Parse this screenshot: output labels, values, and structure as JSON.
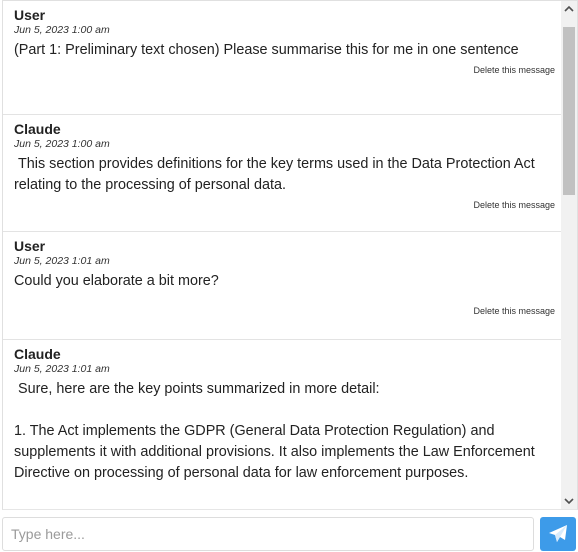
{
  "messages": [
    {
      "author": "User",
      "time": "Jun 5, 2023 1:00 am",
      "text": "(Part 1: Preliminary text chosen) Please summarise this for me in one sentence",
      "delete_label": "Delete this message"
    },
    {
      "author": "Claude",
      "time": "Jun 5, 2023 1:00 am",
      "text": " This section provides definitions for the key terms used in the Data Protection Act relating to the processing of personal data.",
      "delete_label": "Delete this message"
    },
    {
      "author": "User",
      "time": "Jun 5, 2023 1:01 am",
      "text": "Could you elaborate a bit more?",
      "delete_label": "Delete this message"
    },
    {
      "author": "Claude",
      "time": "Jun 5, 2023 1:01 am",
      "text": " Sure, here are the key points summarized in more detail:\n\n1. The Act implements the GDPR (General Data Protection Regulation) and supplements it with additional provisions. It also implements the Law Enforcement Directive on processing of personal data for law enforcement purposes.",
      "delete_label": ""
    }
  ],
  "composer": {
    "placeholder": "Type here...",
    "send_icon": "paper-plane-icon"
  },
  "scrollbar": {
    "up_icon": "chevron-up-icon",
    "down_icon": "chevron-down-icon"
  },
  "colors": {
    "accent": "#3d9be9",
    "divider": "#e3e3e3",
    "scroll_thumb": "#c1c1c1"
  }
}
